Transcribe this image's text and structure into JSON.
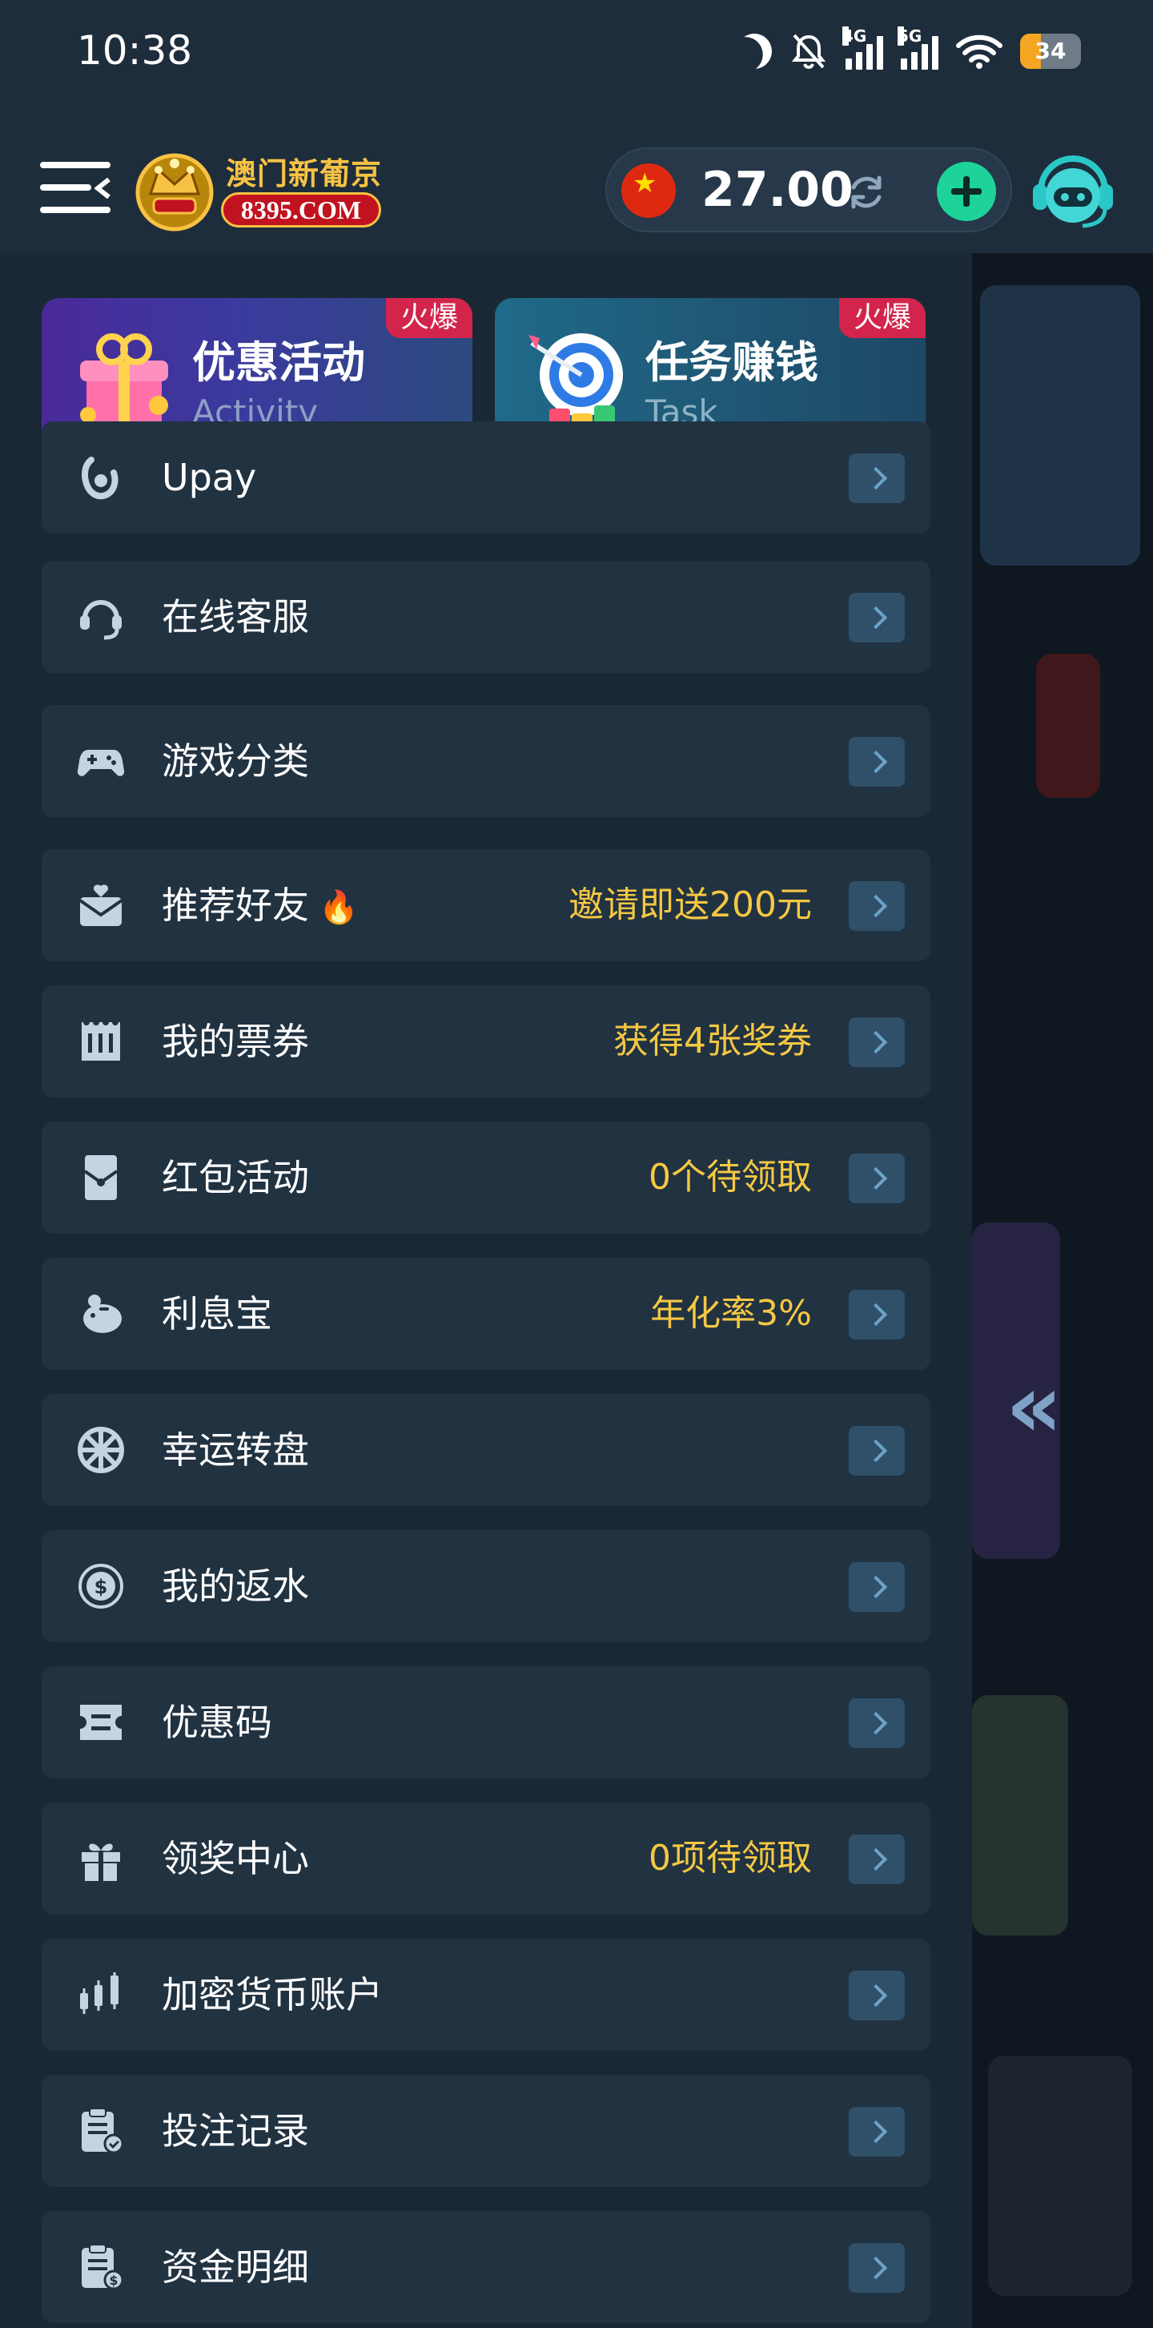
{
  "status_bar": {
    "time": "10:38",
    "network_4g": "4G",
    "network_5g": "5G",
    "battery_level": "34",
    "battery_fraction": 0.34,
    "battery_color": "#f5a623"
  },
  "header": {
    "logo_cn": "澳门新葡京",
    "logo_url": "8395.COM",
    "currency_flag": "china-flag-icon",
    "balance": "27.00",
    "accent_color": "#1ed39a"
  },
  "promos": [
    {
      "title": "优惠活动",
      "subtitle": "Activity",
      "badge": "火爆"
    },
    {
      "title": "任务赚钱",
      "subtitle": "Task",
      "badge": "火爆"
    }
  ],
  "menu": {
    "items": [
      {
        "label": "Upay",
        "extra": "",
        "icon": "upay-icon"
      },
      {
        "label": "在线客服",
        "extra": "",
        "icon": "headset-icon"
      },
      {
        "label": "游戏分类",
        "extra": "",
        "icon": "gamepad-icon"
      },
      {
        "label": "推荐好友",
        "extra": "邀请即送200元",
        "icon": "invite-icon",
        "flame": "🔥"
      },
      {
        "label": "我的票券",
        "extra": "获得4张奖券",
        "icon": "ticket-icon"
      },
      {
        "label": "红包活动",
        "extra": "0个待领取",
        "icon": "red-envelope-icon"
      },
      {
        "label": "利息宝",
        "extra": "年化率3%",
        "icon": "piggy-bank-icon"
      },
      {
        "label": "幸运转盘",
        "extra": "",
        "icon": "wheel-icon"
      },
      {
        "label": "我的返水",
        "extra": "",
        "icon": "rebate-coin-icon"
      },
      {
        "label": "优惠码",
        "extra": "",
        "icon": "coupon-code-icon"
      },
      {
        "label": "领奖中心",
        "extra": "0项待领取",
        "icon": "gift-icon"
      },
      {
        "label": "加密货币账户",
        "extra": "",
        "icon": "crypto-chart-icon"
      },
      {
        "label": "投注记录",
        "extra": "",
        "icon": "bet-record-icon"
      },
      {
        "label": "资金明细",
        "extra": "",
        "icon": "fund-detail-icon"
      }
    ]
  },
  "overlay": {
    "collapse_glyph": "«"
  }
}
